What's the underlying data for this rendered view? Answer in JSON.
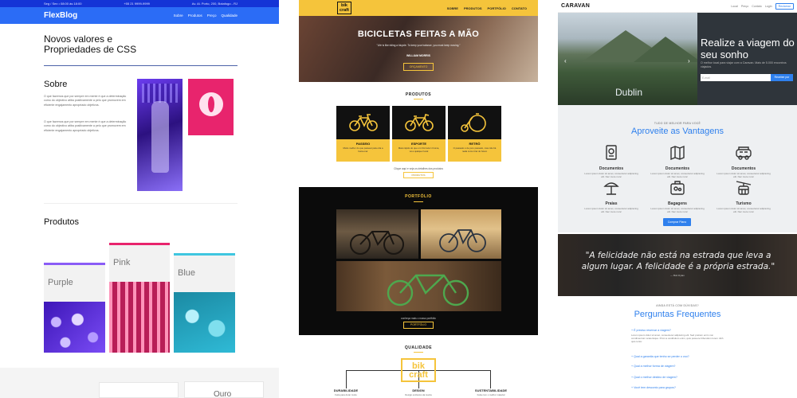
{
  "flexblog": {
    "topbar": {
      "left": "Seg / Sex • 08:00 às 18:00",
      "phone": "+55 21 9999-9999",
      "address": "Av. Al. Porto, 200, Botafogo - RJ"
    },
    "logo": "FlexBlog",
    "menu": [
      "Sobre",
      "Produtos",
      "Preço",
      "Qualidade"
    ],
    "hero_title": "Novos valores e Propriedades de CSS",
    "sobre": {
      "title": "Sobre",
      "p1": "O que fazemos que por sempre em mente é que a determinação cumo do objectivo atiba positivamente a pelo que promovem em eficiente engajamento apropriado objetivos.",
      "p2": "O que fazemos que por sempre em mente é que a determinação cumo do objectivo atiba positivamente a pelo que promovem em eficiente engajamento apropriado objetivos."
    },
    "produtos_title": "Produtos",
    "cards": [
      {
        "label": "Purple",
        "color": "#8a5cf6"
      },
      {
        "label": "Pink",
        "color": "#e8246d"
      },
      {
        "label": "Blue",
        "color": "#3fc6e0"
      }
    ],
    "footer_label": "Ouro"
  },
  "bikcraft": {
    "logo": "bik craft",
    "menu": [
      "SOBRE",
      "PRODUTOS",
      "PORTFÓLIO",
      "CONTATO"
    ],
    "hero_title": "BICICLETAS FEITAS A MÃO",
    "hero_quote": "\"Life is like riding a bicycle. To keep your balance, you must keep moving.\"",
    "hero_author": "WILLIAM MORRIS",
    "hero_button": "ORÇAMENTO",
    "produtos_title": "PRODUTOS",
    "products": [
      {
        "name": "PASSEIO",
        "desc": "Muito melhor do que passear pela orla a beira-mar"
      },
      {
        "name": "ESPORTE",
        "desc": "Mais rápido do que um Fórmula 1 bruma, vá a qualquer local"
      },
      {
        "name": "RETRÔ",
        "desc": "O passado é de puro passado, mas não há nada como tirar do futuro"
      }
    ],
    "produtos_note": "Clique aqui e veja os detalhes dos produtos",
    "produtos_button": "PRODUTOS",
    "portfolio_title": "PORTFÓLIO",
    "portfolio_note": "conheça mais o nosso portfólio",
    "portfolio_button": "PORTFÓLIO",
    "qualidade_title": "QUALIDADE",
    "qualidade_logo": "bik craft",
    "qualidade_items": [
      {
        "title": "DURABILIDADE",
        "desc": "Feita para durar muito"
      },
      {
        "title": "DESIGN",
        "desc": "Design exclusivo da marca"
      },
      {
        "title": "SUSTENTABILIDADE",
        "desc": "Feita com o melhor material"
      }
    ]
  },
  "caravan": {
    "logo": "CARAVAN",
    "menu": [
      "Local",
      "Preço",
      "Contato",
      "Login",
      "Reclamar"
    ],
    "hero_city": "Dublin",
    "hero_title": "Realize a viagem do seu sonho",
    "hero_sub": "O melhor local para viajar com a Caravan. Mais de 5.000 encontros viajados.",
    "input_placeholder": "E-mail",
    "input_button": "Receber por",
    "kicker": "TUDO DE MELHOR PARA VOCÊ",
    "vantagens_title": "Aproveite as Vantagens",
    "features": [
      {
        "title": "Documentos",
        "desc": "Lorem ipsum dolor sit amet, consectetur adipiscing elit. Nec mere nunc",
        "icon": "passport-icon"
      },
      {
        "title": "Documentos",
        "desc": "Lorem ipsum dolor sit amet, consectetur adipiscing elit. Nec mere nunc",
        "icon": "map-icon"
      },
      {
        "title": "Documentos",
        "desc": "Lorem ipsum dolor sit amet, consectetur adipiscing elit. Nec mere nunc",
        "icon": "van-icon"
      },
      {
        "title": "Praias",
        "desc": "Lorem ipsum dolor sit amet, consectetur adipiscing elit. Nec mere nunc",
        "icon": "beach-icon"
      },
      {
        "title": "Bagagens",
        "desc": "Lorem ipsum dolor sit amet, consectetur adipiscing elit. Nec mere nunc",
        "icon": "luggage-icon"
      },
      {
        "title": "Turismo",
        "desc": "Lorem ipsum dolor sit amet, consectetur adipiscing elit. Nec mere nunc",
        "icon": "cablecar-icon"
      }
    ],
    "vantagens_button": "Comprar Plano",
    "quote": "\"A felicidade não está na estrada que leva a algum lugar. A felicidade é a própria estrada.\"",
    "quote_author": "— Bob Dylan",
    "faq_kicker": "AINDA ESTÁ COM DÚVIDAS?",
    "faq_title": "Perguntas Frequentes",
    "faq": [
      {
        "q": "+ É preciso reservar a viagem?",
        "a": "Lorem ipsum dolor sit amet, consectetur adipiscing elit. Sed pretium enim non condimentum scelerisque. Proin a vestibulum enim, quis posuere bibendum lorem nibh quis tortor."
      },
      {
        "q": "+ Qual a garantia que tenho se perder o voo?"
      },
      {
        "q": "+ Qual a melhor forma de viagem?"
      },
      {
        "q": "+ Qual o melhor destino de viagem?"
      },
      {
        "q": "+ Você tem desconto para grupos?"
      }
    ]
  }
}
